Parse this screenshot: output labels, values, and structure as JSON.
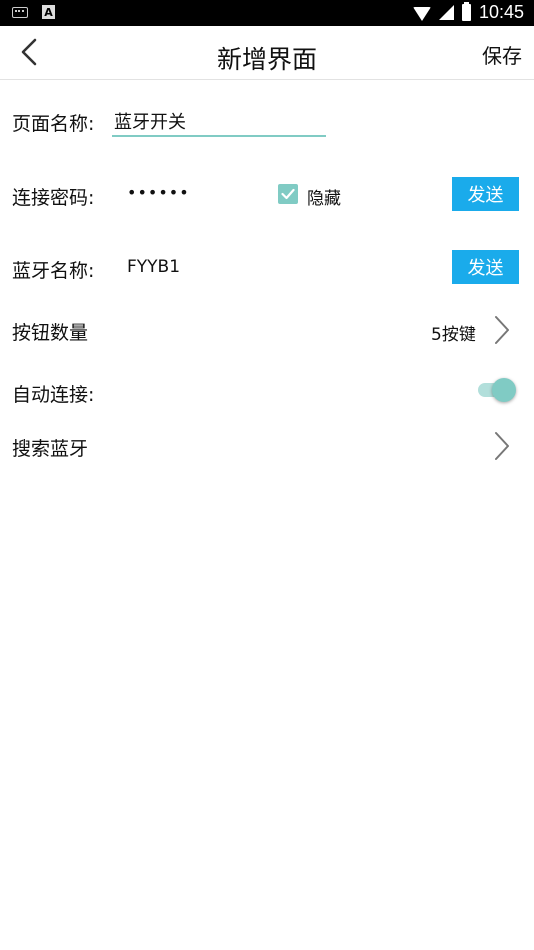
{
  "status_bar": {
    "time": "10:45",
    "left_icons": [
      "keyboard-icon",
      "a-notification-icon"
    ],
    "right_icons": [
      "wifi-icon",
      "signal-icon",
      "battery-icon"
    ]
  },
  "header": {
    "back_icon": "chevron-left-icon",
    "title": "新增界面",
    "save_label": "保存"
  },
  "form": {
    "page_name": {
      "label": "页面名称:",
      "value": "蓝牙开关"
    },
    "password": {
      "label": "连接密码:",
      "value": "••••••",
      "hide_label": "隐藏",
      "hide_checked": true,
      "send_label": "发送"
    },
    "bt_name": {
      "label": "蓝牙名称:",
      "value": "FYYB1",
      "send_label": "发送"
    },
    "button_count": {
      "label": "按钮数量",
      "value": "5按键"
    },
    "auto_connect": {
      "label": "自动连接:",
      "enabled": true
    },
    "search_bt": {
      "label": "搜索蓝牙"
    }
  },
  "colors": {
    "accent": "#80cbc4",
    "accent_light": "#b2dfdb",
    "button_blue": "#1aabeb",
    "status_bar": "#000000"
  }
}
